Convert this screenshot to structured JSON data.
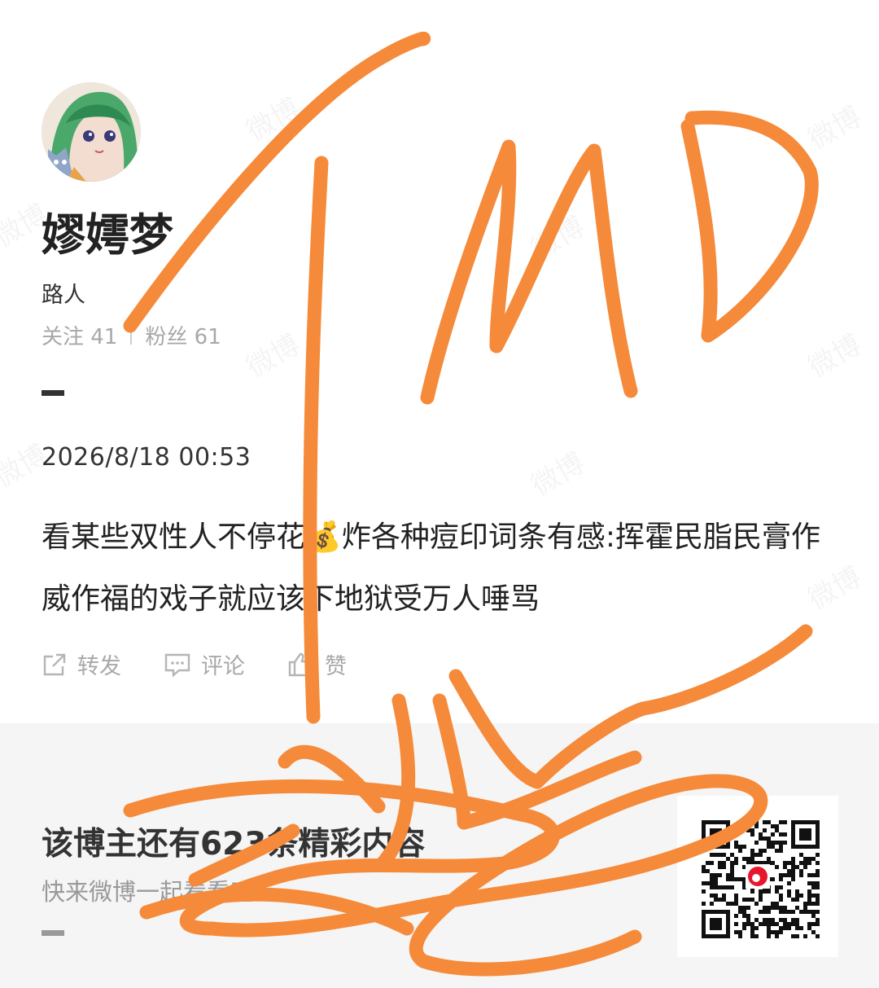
{
  "profile": {
    "name": "嫪嫮梦",
    "role": "路人",
    "follow_label": "关注",
    "follow_count": "41",
    "fans_label": "粉丝",
    "fans_count": "61"
  },
  "post": {
    "date": "2026/8/18 00:53",
    "text_part1": "看某些双性人不停花",
    "money_emoji": "💰",
    "text_part2": "炸各种痘印词条有感:挥霍民脂民膏作威作福的戏子就应该下地狱受万人唾骂"
  },
  "actions": {
    "repost": "转发",
    "comment": "评论",
    "like": "赞"
  },
  "footer": {
    "title": "该博主还有623条精彩内容",
    "subtitle": "快来微博一起看看吧"
  },
  "watermark_text": "微博",
  "colors": {
    "scribble": "#f58a3a",
    "weibo_red": "#e6162d",
    "footer_bg": "#f5f5f5"
  }
}
